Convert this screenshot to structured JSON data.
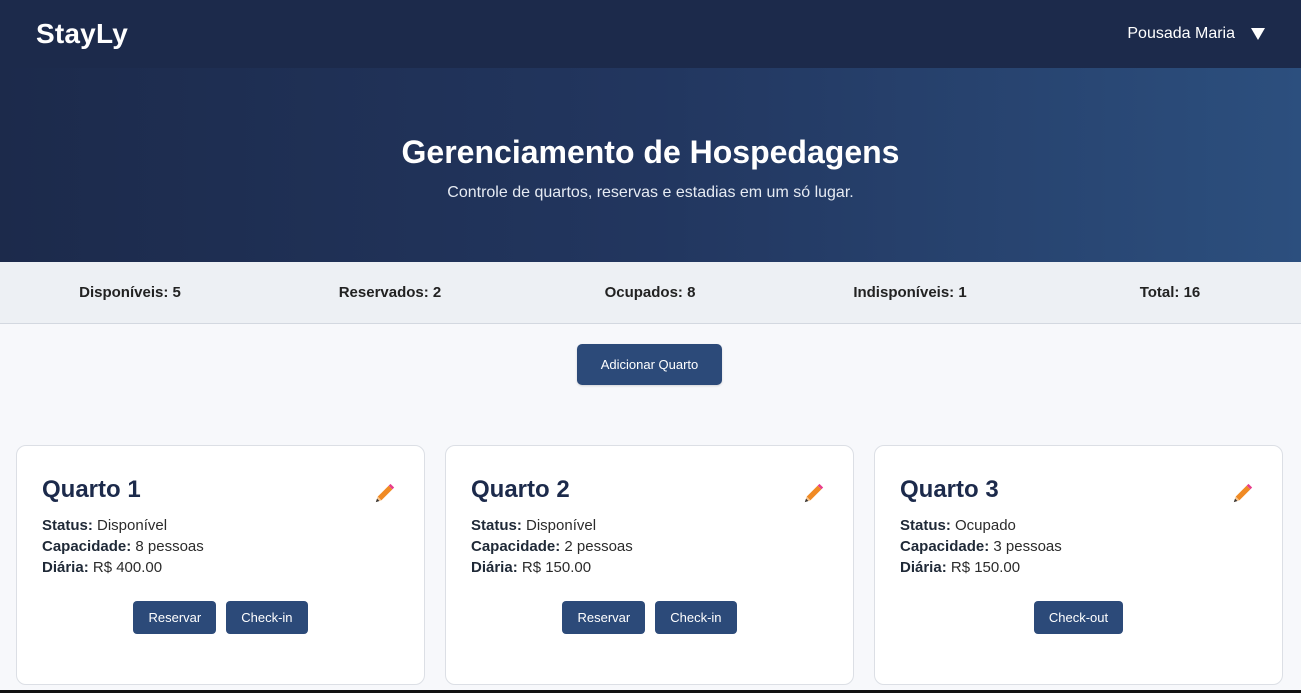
{
  "app": {
    "brand": "StayLy",
    "user_name": "Pousada Maria"
  },
  "hero": {
    "title": "Gerenciamento de Hospedagens",
    "subtitle": "Controle de quartos, reservas e estadias em um só lugar."
  },
  "stats": [
    {
      "label": "Disponíveis: 5"
    },
    {
      "label": "Reservados: 2"
    },
    {
      "label": "Ocupados: 8"
    },
    {
      "label": "Indisponíveis: 1"
    },
    {
      "label": "Total: 16"
    }
  ],
  "add_button": "Adicionar Quarto",
  "labels": {
    "status": "Status:",
    "capacity": "Capacidade:",
    "rate": "Diária:"
  },
  "rooms": [
    {
      "title": "Quarto 1",
      "status": "Disponível",
      "capacity": "8 pessoas",
      "rate": "R$ 400.00",
      "actions": [
        "Reservar",
        "Check-in"
      ]
    },
    {
      "title": "Quarto 2",
      "status": "Disponível",
      "capacity": "2 pessoas",
      "rate": "R$ 150.00",
      "actions": [
        "Reservar",
        "Check-in"
      ]
    },
    {
      "title": "Quarto 3",
      "status": "Ocupado",
      "capacity": "3 pessoas",
      "rate": "R$ 150.00",
      "actions": [
        "Check-out"
      ]
    }
  ],
  "icons": {
    "edit": "pencil-icon",
    "menu": "chevron-down-icon"
  },
  "colors": {
    "navbar": "#1c2a4b",
    "primary_button": "#2c4a79",
    "accent_pencil": "#f08a24"
  }
}
